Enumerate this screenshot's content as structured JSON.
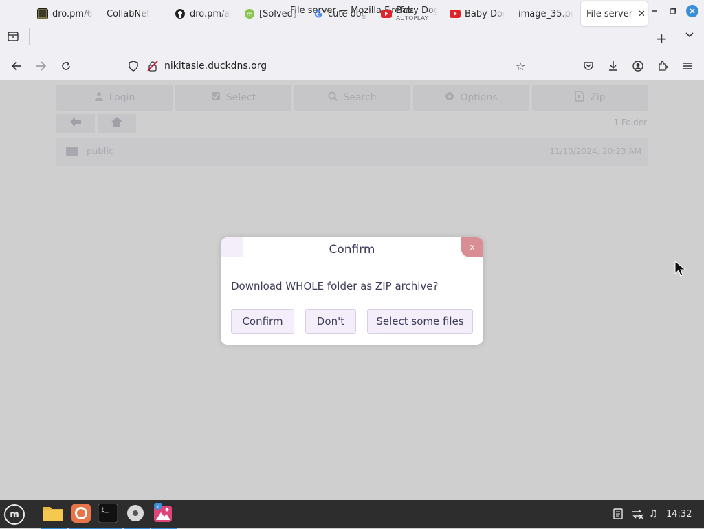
{
  "window": {
    "title": "File server — Mozilla Firefox"
  },
  "tabs": [
    {
      "label": "dro.pm/6",
      "icon": "terminal-favicon-icon"
    },
    {
      "label": "CollabNet",
      "icon": "none"
    },
    {
      "label": "dro.pm/a",
      "icon": "github-icon"
    },
    {
      "label": "[Solved] I",
      "icon": "linuxmint-forum-icon"
    },
    {
      "label": "cute dog",
      "icon": "google-icon"
    },
    {
      "label": "Baby Dog",
      "sub": "AUTOPLAY",
      "icon": "youtube-icon"
    },
    {
      "label": "Baby Dog",
      "icon": "youtube-icon"
    },
    {
      "label": "image_35.pn",
      "icon": "none"
    },
    {
      "label": "File server",
      "icon": "none",
      "active": true
    }
  ],
  "navbar": {
    "url": "nikitasie.duckdns.org"
  },
  "page": {
    "toolbar": [
      {
        "label": "Login",
        "icon": "user-icon"
      },
      {
        "label": "Select",
        "icon": "checkbox-icon"
      },
      {
        "label": "Search",
        "icon": "search-icon"
      },
      {
        "label": "Options",
        "icon": "gear-icon"
      },
      {
        "label": "Zip",
        "icon": "zip-file-icon"
      }
    ],
    "folder_count": "1 Folder",
    "folder": {
      "name": "public",
      "date": "11/10/2024, 20:23 AM"
    }
  },
  "dialog": {
    "title": "Confirm",
    "close_label": "x",
    "message": "Download WHOLE folder as ZIP archive?",
    "buttons": {
      "confirm": "Confirm",
      "dont": "Don't",
      "select": "Select some files"
    }
  },
  "taskbar": {
    "badge": "2",
    "clock": "14:32"
  },
  "colors": {
    "accent": "#3b8fd9",
    "dialog_close": "#d98e96",
    "dialog_button_bg": "#f3eef9"
  }
}
